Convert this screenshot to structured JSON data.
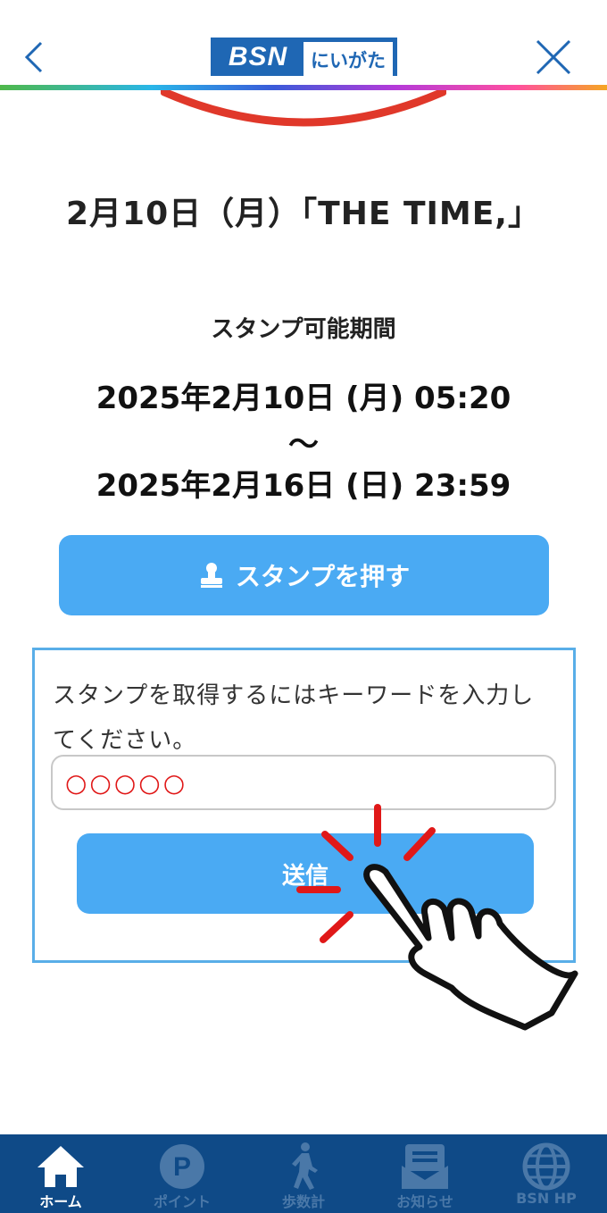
{
  "header": {
    "logo_brand": "BSN",
    "logo_region": "にいがた"
  },
  "main": {
    "title": "2月10日（月）「THE TIME,」",
    "period_label": "スタンプ可能期間",
    "period_start": "2025年2月10日 (月) 05:20",
    "period_sep": "～",
    "period_end": "2025年2月16日 (日) 23:59",
    "stamp_button_label": "スタンプを押す"
  },
  "keyword_form": {
    "instruction": "スタンプを取得するにはキーワードを入力してください。",
    "input_value": "○○○○○",
    "submit_label": "送信"
  },
  "tabbar": {
    "items": [
      {
        "label": "ホーム",
        "icon": "home-icon",
        "active": true
      },
      {
        "label": "ポイント",
        "icon": "point-icon",
        "active": false
      },
      {
        "label": "歩数計",
        "icon": "walker-icon",
        "active": false
      },
      {
        "label": "お知らせ",
        "icon": "notification-icon",
        "active": false
      },
      {
        "label": "BSN HP",
        "icon": "globe-icon",
        "active": false
      }
    ]
  },
  "colors": {
    "brand_blue": "#1f67b4",
    "button_blue": "#4aaaf3",
    "tabbar_bg": "#0f4a87",
    "accent_red": "#e01818"
  }
}
